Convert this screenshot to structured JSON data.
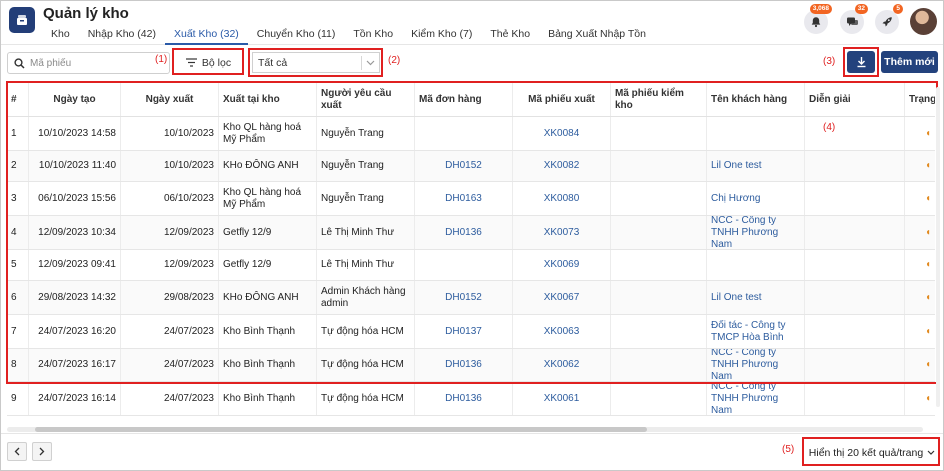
{
  "app": {
    "title": "Quản lý kho"
  },
  "tabs": [
    {
      "label": "Kho"
    },
    {
      "label": "Nhập Kho (42)"
    },
    {
      "label": "Xuất Kho (32)"
    },
    {
      "label": "Chuyển Kho (11)"
    },
    {
      "label": "Tồn Kho"
    },
    {
      "label": "Kiểm Kho (7)"
    },
    {
      "label": "Thẻ Kho"
    },
    {
      "label": "Bảng Xuất Nhập Tồn"
    }
  ],
  "header_icons": {
    "notifications_badge": "3,068",
    "messages_badge": "32",
    "rocket_badge": "5"
  },
  "toolbar": {
    "search_placeholder": "Mã phiếu",
    "filter_label": "Bộ lọc",
    "select_value": "Tất cả",
    "add_label": "Thêm mới"
  },
  "annotations": {
    "a1": "(1)",
    "a2": "(2)",
    "a3": "(3)",
    "a4": "(4)",
    "a5": "(5)"
  },
  "table": {
    "columns": [
      "#",
      "Ngày tạo",
      "Ngày xuất",
      "Xuất tại kho",
      "Người yêu cầu xuất",
      "Mã đơn hàng",
      "Mã phiếu xuất",
      "Mã phiếu kiểm kho",
      "Tên khách hàng",
      "Diễn giải",
      "Trạng"
    ],
    "rows": [
      {
        "no": "1",
        "created": "10/10/2023 14:58",
        "exported": "10/10/2023",
        "warehouse": "Kho QL hàng hoá Mỹ Phẩm",
        "requester": "Nguyễn Trang",
        "order": "",
        "slip": "XK0084",
        "check": "",
        "customer": ""
      },
      {
        "no": "2",
        "created": "10/10/2023 11:40",
        "exported": "10/10/2023",
        "warehouse": "KHo ĐÔNG ANH",
        "requester": "Nguyễn Trang",
        "order": "DH0152",
        "slip": "XK0082",
        "check": "",
        "customer": "Lil One test"
      },
      {
        "no": "3",
        "created": "06/10/2023 15:56",
        "exported": "06/10/2023",
        "warehouse": "Kho QL hàng hoá Mỹ Phẩm",
        "requester": "Nguyễn Trang",
        "order": "DH0163",
        "slip": "XK0080",
        "check": "",
        "customer": "Chị Hương"
      },
      {
        "no": "4",
        "created": "12/09/2023 10:34",
        "exported": "12/09/2023",
        "warehouse": "Getfly 12/9",
        "requester": "Lê Thị Minh Thư",
        "order": "DH0136",
        "slip": "XK0073",
        "check": "",
        "customer": "NCC - Công ty TNHH Phương Nam"
      },
      {
        "no": "5",
        "created": "12/09/2023 09:41",
        "exported": "12/09/2023",
        "warehouse": "Getfly 12/9",
        "requester": "Lê Thị Minh Thư",
        "order": "",
        "slip": "XK0069",
        "check": "",
        "customer": ""
      },
      {
        "no": "6",
        "created": "29/08/2023 14:32",
        "exported": "29/08/2023",
        "warehouse": "KHo ĐÔNG ANH",
        "requester": "Admin Khách hàng admin",
        "order": "DH0152",
        "slip": "XK0067",
        "check": "",
        "customer": "Lil One test"
      },
      {
        "no": "7",
        "created": "24/07/2023 16:20",
        "exported": "24/07/2023",
        "warehouse": "Kho Bình Thạnh",
        "requester": "Tự động hóa HCM",
        "order": "DH0137",
        "slip": "XK0063",
        "check": "",
        "customer": "Đối tác - Công ty TMCP Hòa Bình"
      },
      {
        "no": "8",
        "created": "24/07/2023 16:17",
        "exported": "24/07/2023",
        "warehouse": "Kho Bình Thạnh",
        "requester": "Tự động hóa HCM",
        "order": "DH0136",
        "slip": "XK0062",
        "check": "",
        "customer": "NCC - Công ty TNHH Phương Nam"
      },
      {
        "no": "9",
        "created": "24/07/2023 16:14",
        "exported": "24/07/2023",
        "warehouse": "Kho Bình Thạnh",
        "requester": "Tự động hóa HCM",
        "order": "DH0136",
        "slip": "XK0061",
        "check": "",
        "customer": "NCC - Công ty TNHH Phương Nam"
      }
    ]
  },
  "footer": {
    "per_page_label": "Hiển thị 20 kết quả/trang"
  },
  "colors": {
    "brand": "#23427d",
    "link": "#2d5c9e",
    "annotation": "#e02020",
    "badge": "#f26522"
  }
}
